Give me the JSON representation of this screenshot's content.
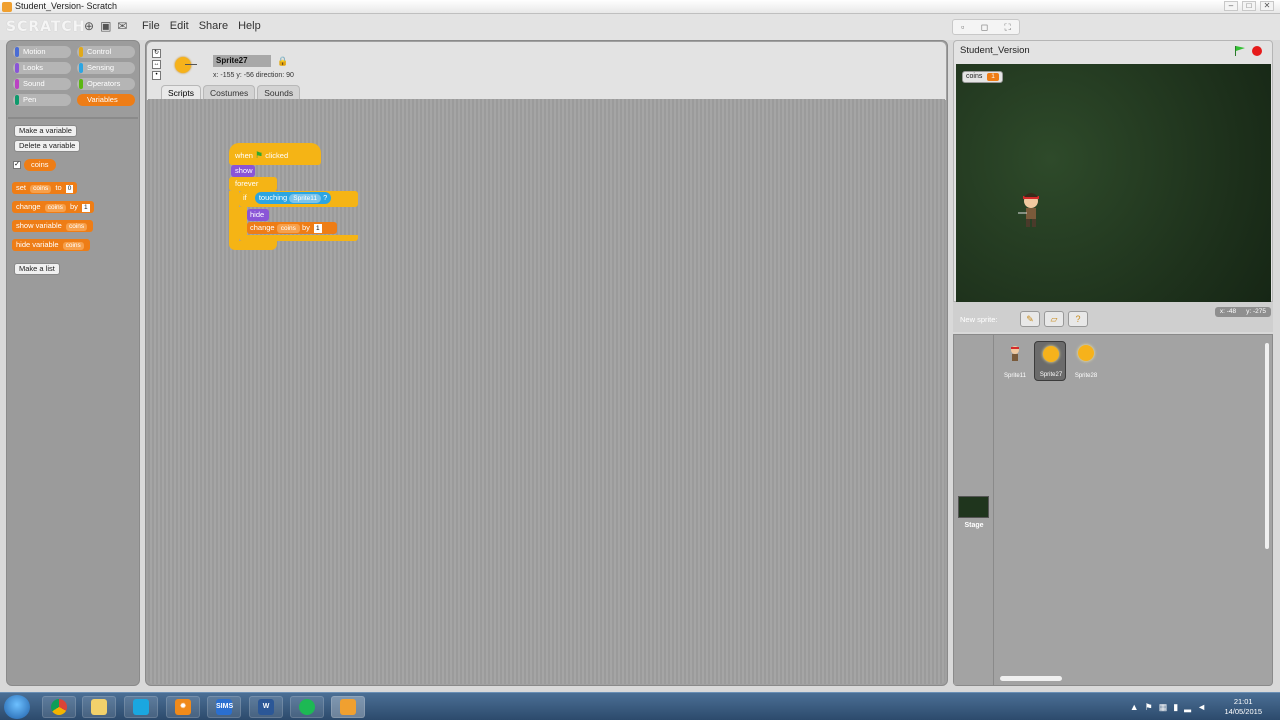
{
  "window": {
    "title": "Student_Version- Scratch"
  },
  "menubar": {
    "logo": "SCRATCH",
    "menus": [
      "File",
      "Edit",
      "Share",
      "Help"
    ]
  },
  "palette": {
    "categories": [
      {
        "label": "Motion",
        "color": "#4a6cd4",
        "selected": false
      },
      {
        "label": "Control",
        "color": "#e1a91a",
        "selected": false
      },
      {
        "label": "Looks",
        "color": "#8a55d7",
        "selected": false
      },
      {
        "label": "Sensing",
        "color": "#2ca5e2",
        "selected": false
      },
      {
        "label": "Sound",
        "color": "#bb42c3",
        "selected": false
      },
      {
        "label": "Operators",
        "color": "#5cb712",
        "selected": false
      },
      {
        "label": "Pen",
        "color": "#0e9a6c",
        "selected": false
      },
      {
        "label": "Variables",
        "color": "#ee7d16",
        "selected": true
      }
    ],
    "make_variable": "Make a variable",
    "delete_variable": "Delete a variable",
    "variable_name": "coins",
    "set_block": {
      "label": "set",
      "var": "coins",
      "to": "to",
      "value": "0"
    },
    "change_block": {
      "label": "change",
      "var": "coins",
      "by": "by",
      "value": "1"
    },
    "show_block": {
      "label": "show variable",
      "var": "coins"
    },
    "hide_block": {
      "label": "hide variable",
      "var": "coins"
    },
    "make_list": "Make a list"
  },
  "sprite": {
    "name": "Sprite27",
    "coords": "x: -155  y: -56   direction: 90"
  },
  "tabs": [
    "Scripts",
    "Costumes",
    "Sounds"
  ],
  "script": {
    "hat": {
      "when": "when",
      "clicked": "clicked"
    },
    "show": "show",
    "forever": "forever",
    "if": "if",
    "touching": "touching",
    "touching_target": "Sprite11",
    "hide": "hide",
    "change": "change",
    "change_var": "coins",
    "change_by": "by",
    "change_value": "1"
  },
  "stage": {
    "title": "Student_Version",
    "watcher_label": "coins",
    "watcher_value": "1",
    "mouse_x": "x: -48",
    "mouse_y": "y: -275"
  },
  "new_sprite": {
    "label": "New sprite:"
  },
  "sprites": [
    {
      "name": "Sprite11",
      "type": "hero",
      "selected": false
    },
    {
      "name": "Sprite27",
      "type": "coin",
      "selected": true
    },
    {
      "name": "Sprite28",
      "type": "coin",
      "selected": false
    }
  ],
  "stage_thumb_label": "Stage",
  "taskbar": {
    "time": "21:01",
    "date": "14/05/2015",
    "apps": [
      "Chrome",
      "Explorer",
      "Skype",
      "Settings",
      "SIMS",
      "Word",
      "Spotify",
      "Scratch"
    ]
  }
}
